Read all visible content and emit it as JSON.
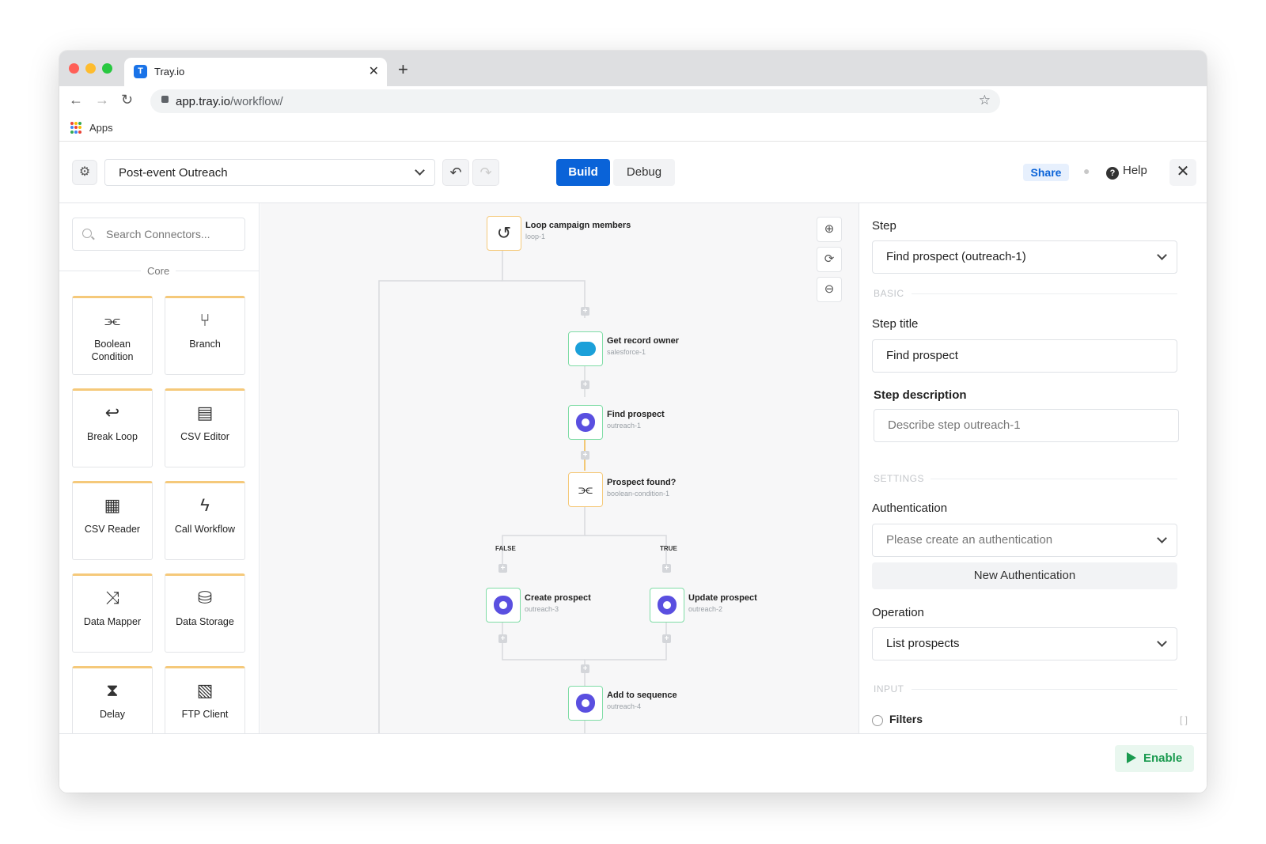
{
  "browser": {
    "tab_title": "Tray.io",
    "tab_favicon": "T",
    "url_host": "app.tray.io",
    "url_path": "/workflow/",
    "bookmarks_apps": "Apps"
  },
  "header": {
    "workflow_name": "Post-event Outreach",
    "build_label": "Build",
    "debug_label": "Debug",
    "share_label": "Share",
    "help_label": "Help"
  },
  "connectors": {
    "search_placeholder": "Search Connectors...",
    "group_label": "Core",
    "items": [
      {
        "label": "Boolean Condition",
        "icon": "boolean-condition-icon"
      },
      {
        "label": "Branch",
        "icon": "branch-icon"
      },
      {
        "label": "Break Loop",
        "icon": "break-loop-icon"
      },
      {
        "label": "CSV Editor",
        "icon": "csv-editor-icon"
      },
      {
        "label": "CSV Reader",
        "icon": "csv-reader-icon"
      },
      {
        "label": "Call Workflow",
        "icon": "call-workflow-icon"
      },
      {
        "label": "Data Mapper",
        "icon": "data-mapper-icon"
      },
      {
        "label": "Data Storage",
        "icon": "data-storage-icon"
      },
      {
        "label": "Delay",
        "icon": "delay-icon"
      },
      {
        "label": "FTP Client",
        "icon": "ftp-client-icon"
      }
    ]
  },
  "canvas": {
    "nodes": {
      "loop": {
        "title": "Loop campaign members",
        "id": "loop-1"
      },
      "record_owner": {
        "title": "Get record owner",
        "id": "salesforce-1"
      },
      "find_prospect": {
        "title": "Find prospect",
        "id": "outreach-1"
      },
      "prospect_found": {
        "title": "Prospect found?",
        "id": "boolean-condition-1"
      },
      "create_prospect": {
        "title": "Create prospect",
        "id": "outreach-3"
      },
      "update_prospect": {
        "title": "Update prospect",
        "id": "outreach-2"
      },
      "add_sequence": {
        "title": "Add to sequence",
        "id": "outreach-4"
      }
    },
    "branch_false": "FALSE",
    "branch_true": "TRUE"
  },
  "properties": {
    "step_label": "Step",
    "step_value": "Find prospect (outreach-1)",
    "section_basic": "BASIC",
    "step_title_label": "Step title",
    "step_title_value": "Find prospect",
    "step_desc_label": "Step description",
    "step_desc_placeholder": "Describe step outreach-1",
    "section_settings": "SETTINGS",
    "auth_label": "Authentication",
    "auth_placeholder": "Please create an authentication",
    "new_auth_label": "New Authentication",
    "operation_label": "Operation",
    "operation_value": "List prospects",
    "section_input": "INPUT",
    "filters_label": "Filters",
    "filters_type": "[ ]"
  },
  "footer": {
    "enable_label": "Enable"
  },
  "colors": {
    "primary": "#0a63d8",
    "outreach": "#5a4fe0",
    "salesforce": "#1ba0d9",
    "node_green": "#7fdca6",
    "node_orange": "#f5c97a",
    "enable_green": "#1a9a4f"
  }
}
